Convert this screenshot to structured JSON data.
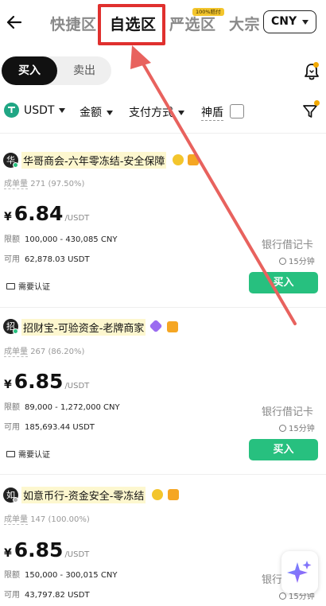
{
  "header": {
    "tabs": [
      {
        "label": "快捷区",
        "active": false
      },
      {
        "label": "自选区",
        "active": true
      },
      {
        "label": "严选区",
        "active": false,
        "badge": "100%赔付"
      },
      {
        "label": "大宗",
        "active": false
      }
    ],
    "currency": "CNY"
  },
  "trade_side": {
    "buy": "买入",
    "sell": "卖出",
    "selected": "buy"
  },
  "filters": {
    "coin": "USDT",
    "amount": "金额",
    "payment": "支付方式",
    "shield": "神盾",
    "shield_checked": false
  },
  "listings": [
    {
      "avatar": "华",
      "online_color": "#27c07f",
      "merchant": "华哥商会-六年零冻结-安全保障",
      "orders_label": "成单量",
      "orders": "271 (97.50%)",
      "currency_symbol": "¥",
      "price": "6.84",
      "unit": "/USDT",
      "limit_label": "限额",
      "limit": "100,000 - 430,085 CNY",
      "available_label": "可用",
      "available": "62,878.03 USDT",
      "payment": "银行借记卡",
      "time": "15分钟",
      "action": "买入",
      "verify": "需要认证"
    },
    {
      "avatar": "招",
      "online_color": "#27c07f",
      "merchant": "招财宝-可验资金-老牌商家",
      "orders_label": "成单量",
      "orders": "267 (86.20%)",
      "currency_symbol": "¥",
      "price": "6.85",
      "unit": "/USDT",
      "limit_label": "限额",
      "limit": "89,000 - 1,272,000 CNY",
      "available_label": "可用",
      "available": "185,693.44 USDT",
      "payment": "银行借记卡",
      "time": "15分钟",
      "action": "买入",
      "verify": "需要认证"
    },
    {
      "avatar": "如",
      "online_color": "#b0b0b0",
      "merchant": "如意币行-资金安全-零冻结",
      "orders_label": "成单量",
      "orders": "147 (100.00%)",
      "currency_symbol": "¥",
      "price": "6.85",
      "unit": "/USDT",
      "limit_label": "限额",
      "limit": "150,000 - 300,015 CNY",
      "available_label": "可用",
      "available": "43,797.82 USDT",
      "payment": "银行",
      "time": "15分钟"
    }
  ],
  "colors": {
    "buy_green": "#27c07f",
    "highlight_red": "#e0302e",
    "badge_yellow": "#f3c52c",
    "usdt_green": "#20a684"
  },
  "icons": [
    "back-arrow-icon",
    "chevron-down-icon",
    "bell-icon",
    "usdt-icon",
    "filter-icon",
    "clock-icon",
    "id-card-icon",
    "gold-badge-icon",
    "shield-badge-icon",
    "diamond-badge-icon",
    "sparkle-icon"
  ]
}
